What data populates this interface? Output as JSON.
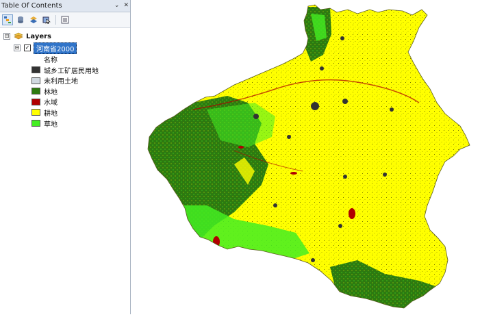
{
  "toc": {
    "title": "Table Of Contents",
    "pin_glyph": "⌄",
    "close_glyph": "✕",
    "root": {
      "label": "Layers",
      "expander": "⊟"
    },
    "layer": {
      "label": "河南省2000",
      "expander": "⊟",
      "checked": true,
      "check_glyph": "✓"
    },
    "field_label": "名称",
    "legend": [
      {
        "label": "城乡工矿居民用地",
        "color": "#333333"
      },
      {
        "label": "未利用土地",
        "color": "#d0d8e0"
      },
      {
        "label": "林地",
        "color": "#2d7a10"
      },
      {
        "label": "水域",
        "color": "#b00000"
      },
      {
        "label": "耕地",
        "color": "#ffff00"
      },
      {
        "label": "草地",
        "color": "#44ee22"
      }
    ]
  },
  "toolbar": {
    "buttons": [
      "list-by-drawing-order-icon",
      "list-by-source-icon",
      "list-by-visibility-icon",
      "list-by-selection-icon",
      "options-icon"
    ]
  },
  "map": {
    "colors": {
      "farmland": "#ffff00",
      "forest": "#2d7a10",
      "grassland": "#44ee22",
      "water": "#b00000",
      "urban": "#333333"
    }
  }
}
